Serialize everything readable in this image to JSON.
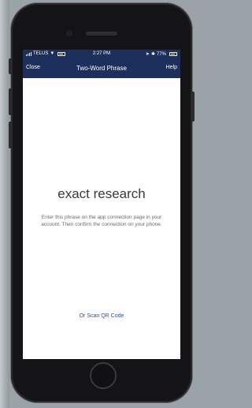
{
  "status_bar": {
    "carrier": "TELUS",
    "time": "2:27 PM",
    "battery": "77%"
  },
  "nav": {
    "close_label": "Close",
    "title": "Two-Word Phrase",
    "help_label": "Help"
  },
  "content": {
    "phrase": "exact research",
    "instructions": "Enter this phrase on the app connection page in your account. Then confirm the connection on your phone.",
    "scan_link": "Or Scan QR Code"
  },
  "colors": {
    "nav_background": "#1d2f5c",
    "link": "#2b4fa3"
  }
}
